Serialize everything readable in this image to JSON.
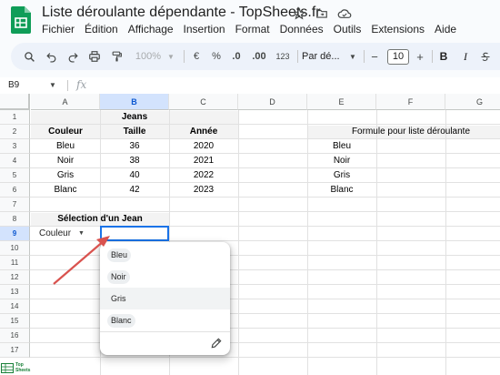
{
  "app": {
    "title": "Liste déroulante dépendante - TopSheets.fr",
    "icons": [
      "star-icon",
      "move-to-folder-icon",
      "cloud-status-icon"
    ],
    "colors": {
      "logo": "#0f9d58",
      "selection": "#1a73e8",
      "header_selected": "#d3e3fd",
      "arrow": "#d9534f",
      "toolbar_bg": "#edf2fa"
    }
  },
  "menu": [
    "Fichier",
    "Édition",
    "Affichage",
    "Insertion",
    "Format",
    "Données",
    "Outils",
    "Extensions",
    "Aide"
  ],
  "toolbar": {
    "zoom": "100%",
    "currency": "€",
    "percent": "%",
    "decrease_decimals": ".0",
    "increase_decimals": ".00",
    "number_format": "123",
    "font": "Par dé...",
    "minus": "−",
    "font_size": "10",
    "plus": "+",
    "bold": "B",
    "italic": "I"
  },
  "formula_bar": {
    "cell_ref": "B9",
    "fx": "fx",
    "value": ""
  },
  "columns": [
    "A",
    "B",
    "C",
    "D",
    "E",
    "F",
    "G"
  ],
  "rows": [
    "1",
    "2",
    "3",
    "4",
    "5",
    "6",
    "7",
    "8",
    "9",
    "10",
    "11",
    "12",
    "13",
    "14",
    "15",
    "16",
    "17"
  ],
  "sheet": {
    "jeans_header": "Jeans",
    "headers": [
      "Couleur",
      "Taille",
      "Année"
    ],
    "data": [
      [
        "Bleu",
        "36",
        "2020"
      ],
      [
        "Noir",
        "38",
        "2021"
      ],
      [
        "Gris",
        "40",
        "2022"
      ],
      [
        "Blanc",
        "42",
        "2023"
      ]
    ],
    "formula_header": "Formule pour liste déroulante",
    "formula_values": [
      "Bleu",
      "Noir",
      "Gris",
      "Blanc"
    ],
    "selection_title": "Sélection d'un Jean",
    "selection_chip": "Couleur"
  },
  "dropdown": {
    "options": [
      "Bleu",
      "Noir",
      "Gris",
      "Blanc"
    ],
    "highlighted": "Gris"
  },
  "watermark": {
    "line1": "Top",
    "line2": "Sheets"
  }
}
